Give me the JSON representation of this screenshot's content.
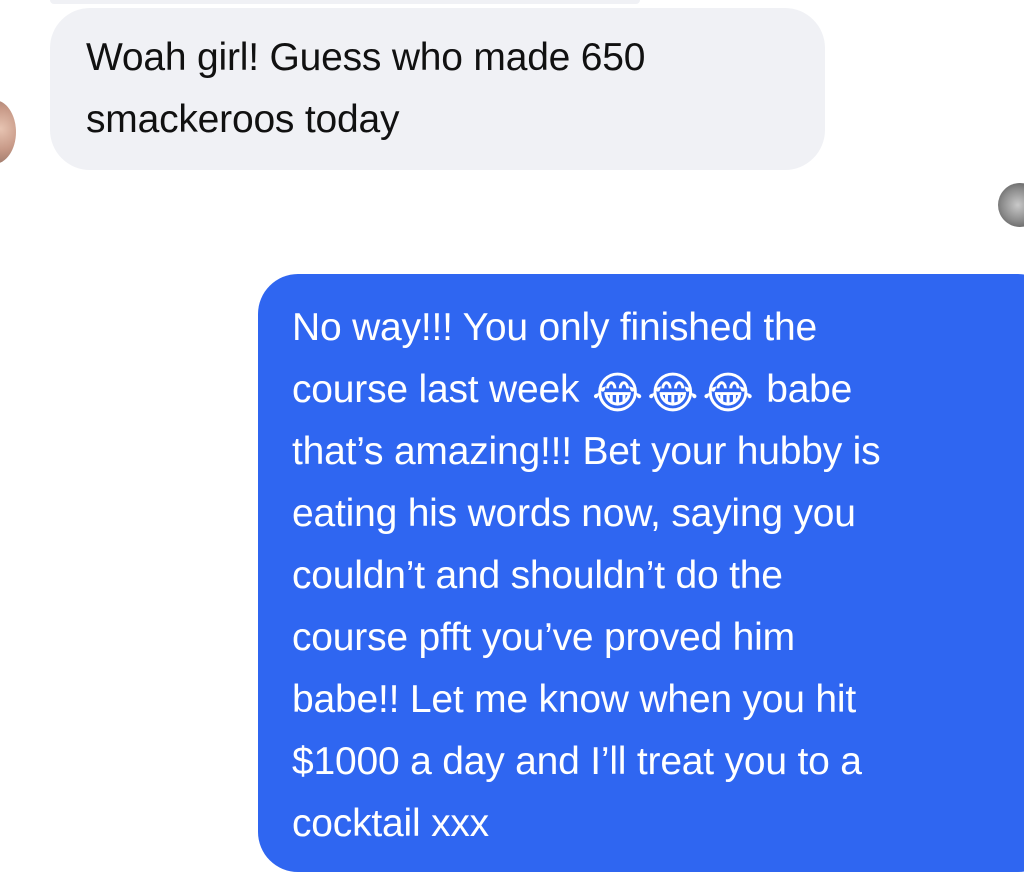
{
  "messages": {
    "received": {
      "lines": [
        "Woah girl! Guess who made 650",
        "smackeroos today"
      ]
    },
    "sent": {
      "line1": "No way!!! You only finished the",
      "line2_before": "course last week ",
      "line2_emojis": [
        "😂",
        "😂",
        "😂"
      ],
      "line2_after": " babe",
      "line3": "that’s amazing!!! Bet your hubby is",
      "line4": "eating his words now, saying you",
      "line5": "couldn’t and shouldn’t do the",
      "line6": "course pfft you’ve proved him",
      "line7": "babe!! Let me know when you hit",
      "line8": "$1000 a day and I’ll treat you to a",
      "line9": "cocktail xxx"
    }
  },
  "colors": {
    "sent_bubble": "#2f66f1",
    "received_bubble": "#f0f1f5",
    "sent_text": "#ffffff",
    "received_text": "#111111"
  },
  "icons": {
    "left_avatar": "contact-avatar",
    "right_avatar": "own-avatar",
    "emoji": "face-with-tears-of-joy"
  }
}
